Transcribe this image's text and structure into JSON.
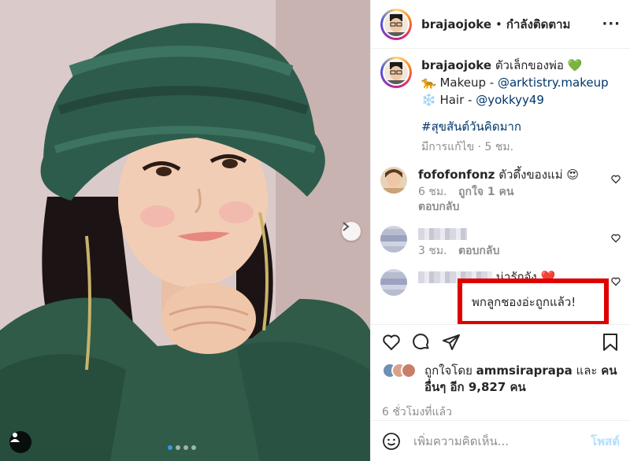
{
  "post": {
    "author": "brajaojoke",
    "follow_status": "กำลังติดตาม",
    "more_icon": "more-horizontal-icon"
  },
  "caption": {
    "username": "brajaojoke",
    "text": "ตัวเล็กของพ่อ",
    "emoji": "💚",
    "line1_prefix": "🐆 Makeup -",
    "line1_mention": "@arktistry.makeup",
    "line2_prefix": "❄️ Hair -",
    "line2_mention": "@yokkyy49",
    "hashtag": "#สุขสันต์วันคิดมาก",
    "edited": "มีการแก้ไข · 5 ชม."
  },
  "comments": [
    {
      "username": "fofofonfonz",
      "text": "ตัวตึ้งของแม่",
      "emoji": "😍",
      "time": "6 ชม.",
      "likes": "ถูกใจ 1 คน",
      "reply": "ตอบกลับ"
    },
    {
      "username": "",
      "text": "พกลูกชองอ่ะถูกแล้ว!",
      "time": "3 ชม.",
      "reply": "ตอบกลับ"
    },
    {
      "username": "",
      "text": "น่ารักจัง",
      "emoji": "❤️"
    }
  ],
  "likes": {
    "prefix": "ถูกใจโดย",
    "user": "ammsiraprapa",
    "and": "และ",
    "others": "คนอื่นๆ อีก 9,827 คน"
  },
  "time_ago": "6 ชั่วโมงที่แล้ว",
  "add_comment": {
    "placeholder": "เพิ่มความคิดเห็น...",
    "post_label": "โพสต์"
  },
  "colors": {
    "link": "#00376b",
    "meta": "#8e8e8e",
    "highlight": "#e00000",
    "post_disabled": "#b2dffc"
  }
}
